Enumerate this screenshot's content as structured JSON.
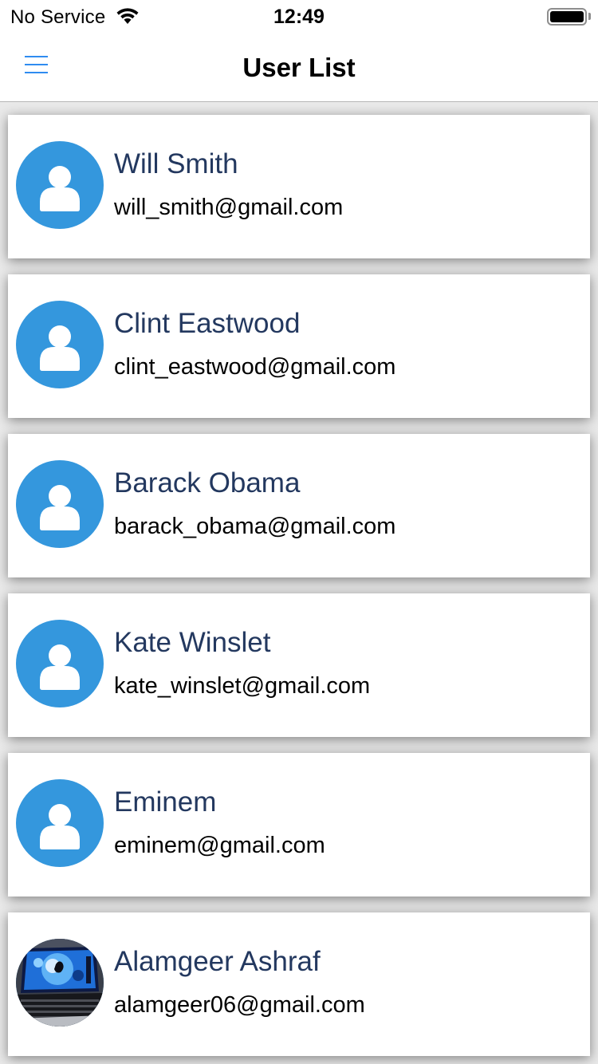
{
  "status_bar": {
    "carrier": "No Service",
    "time": "12:49"
  },
  "nav_bar": {
    "title": "User List",
    "menu_icon": "hamburger-menu-icon"
  },
  "users": [
    {
      "name": "Will Smith",
      "email": "will_smith@gmail.com",
      "avatar": "default-user-icon"
    },
    {
      "name": "Clint Eastwood",
      "email": "clint_eastwood@gmail.com",
      "avatar": "default-user-icon"
    },
    {
      "name": "Barack Obama",
      "email": "barack_obama@gmail.com",
      "avatar": "default-user-icon"
    },
    {
      "name": "Kate Winslet",
      "email": "kate_winslet@gmail.com",
      "avatar": "default-user-icon"
    },
    {
      "name": "Eminem",
      "email": "eminem@gmail.com",
      "avatar": "default-user-icon"
    },
    {
      "name": "Alamgeer Ashraf",
      "email": "alamgeer06@gmail.com",
      "avatar": "laptop-photo"
    }
  ],
  "colors": {
    "accent": "#3497dd",
    "name_text": "#23385f",
    "menu_icon": "#2f8cf0"
  }
}
